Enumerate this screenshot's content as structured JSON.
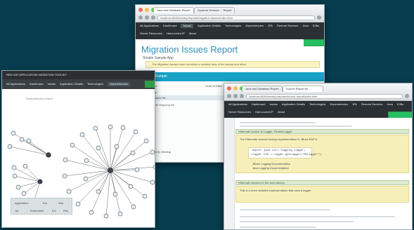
{
  "windows": {
    "report": {
      "tabs": [
        "Java and Database Report ...",
        "Dynamic Session ... Report"
      ],
      "address": "localhost:8080/windup/reports/migration-issues/index.html",
      "nav": [
        "All Applications",
        "Dashboard",
        "Issues",
        "Application Details",
        "Technologies",
        "Dependencies",
        "JPA",
        "Remote Services",
        "Java",
        "EJBs",
        "Server Resources",
        "Hard-coded IP",
        "About"
      ],
      "brand_button": "",
      "title": "Migration Issues Report",
      "subtitle": "Simple Sample App",
      "notice": "The Migration Issues report provides a detailed view of the issues and effort",
      "section_title": "Simple Sample",
      "table_header_1": "# of issues",
      "table_header_2": "Level of Effort",
      "rows": [
        "Mandatory",
        "Java source file",
        "Hibernate Mapping file"
      ],
      "footer": "Generated by Windup"
    },
    "graph": {
      "title": "RED HAT APPLICATION MIGRATION TOOLKIT",
      "nav": [
        "All Applications",
        "Dashboard",
        "Issues",
        "Application Details",
        "Technologies",
        "Dependencies"
      ],
      "label": "Dependencies Graph",
      "legend_1": "Application",
      "legend_2": "Ear",
      "legend_3": "War",
      "legend_4": "Jar",
      "legend_5": "Embedded",
      "legend_6": "Ext",
      "legend_7": "Res"
    },
    "source": {
      "tabs": [
        "Java and Database Report ...",
        "Source Report for ..."
      ],
      "address": "localhost:8080/windup/reports/source-report/index.html",
      "nav": [
        "All Applications",
        "Dashboard",
        "Issues",
        "Application Details",
        "Technologies",
        "Dependencies",
        "JPA",
        "Remote Services",
        "Java",
        "EJBs",
        "Server Resources",
        "Hard-coded IP",
        "About"
      ],
      "brand_button": "",
      "sections": [
        "Hibernate source to Logger: FlexibleLogger",
        "Hibernate session to the Java factory"
      ],
      "paragraph_1": "The Hibernate session factory implementation in JBoss EAP 6",
      "paragraph_2": "This is a more detailed implementation that uses a logger",
      "code_1": "import java.util.logging.Logger;",
      "code_2": "Logger LOG = Logger.getLogger(\"MyLogger\");",
      "link_1": "JBoss Logging Documentation",
      "link_2": "Java Logging Documentation"
    }
  },
  "colors": {
    "background": "#073d4f",
    "nav": "#2b3034",
    "accent_blue": "#18a2c6",
    "accent_green": "#2f9e4c",
    "issue_yellow": "#f7efb9",
    "notice_yellow": "#fbf3c2"
  }
}
